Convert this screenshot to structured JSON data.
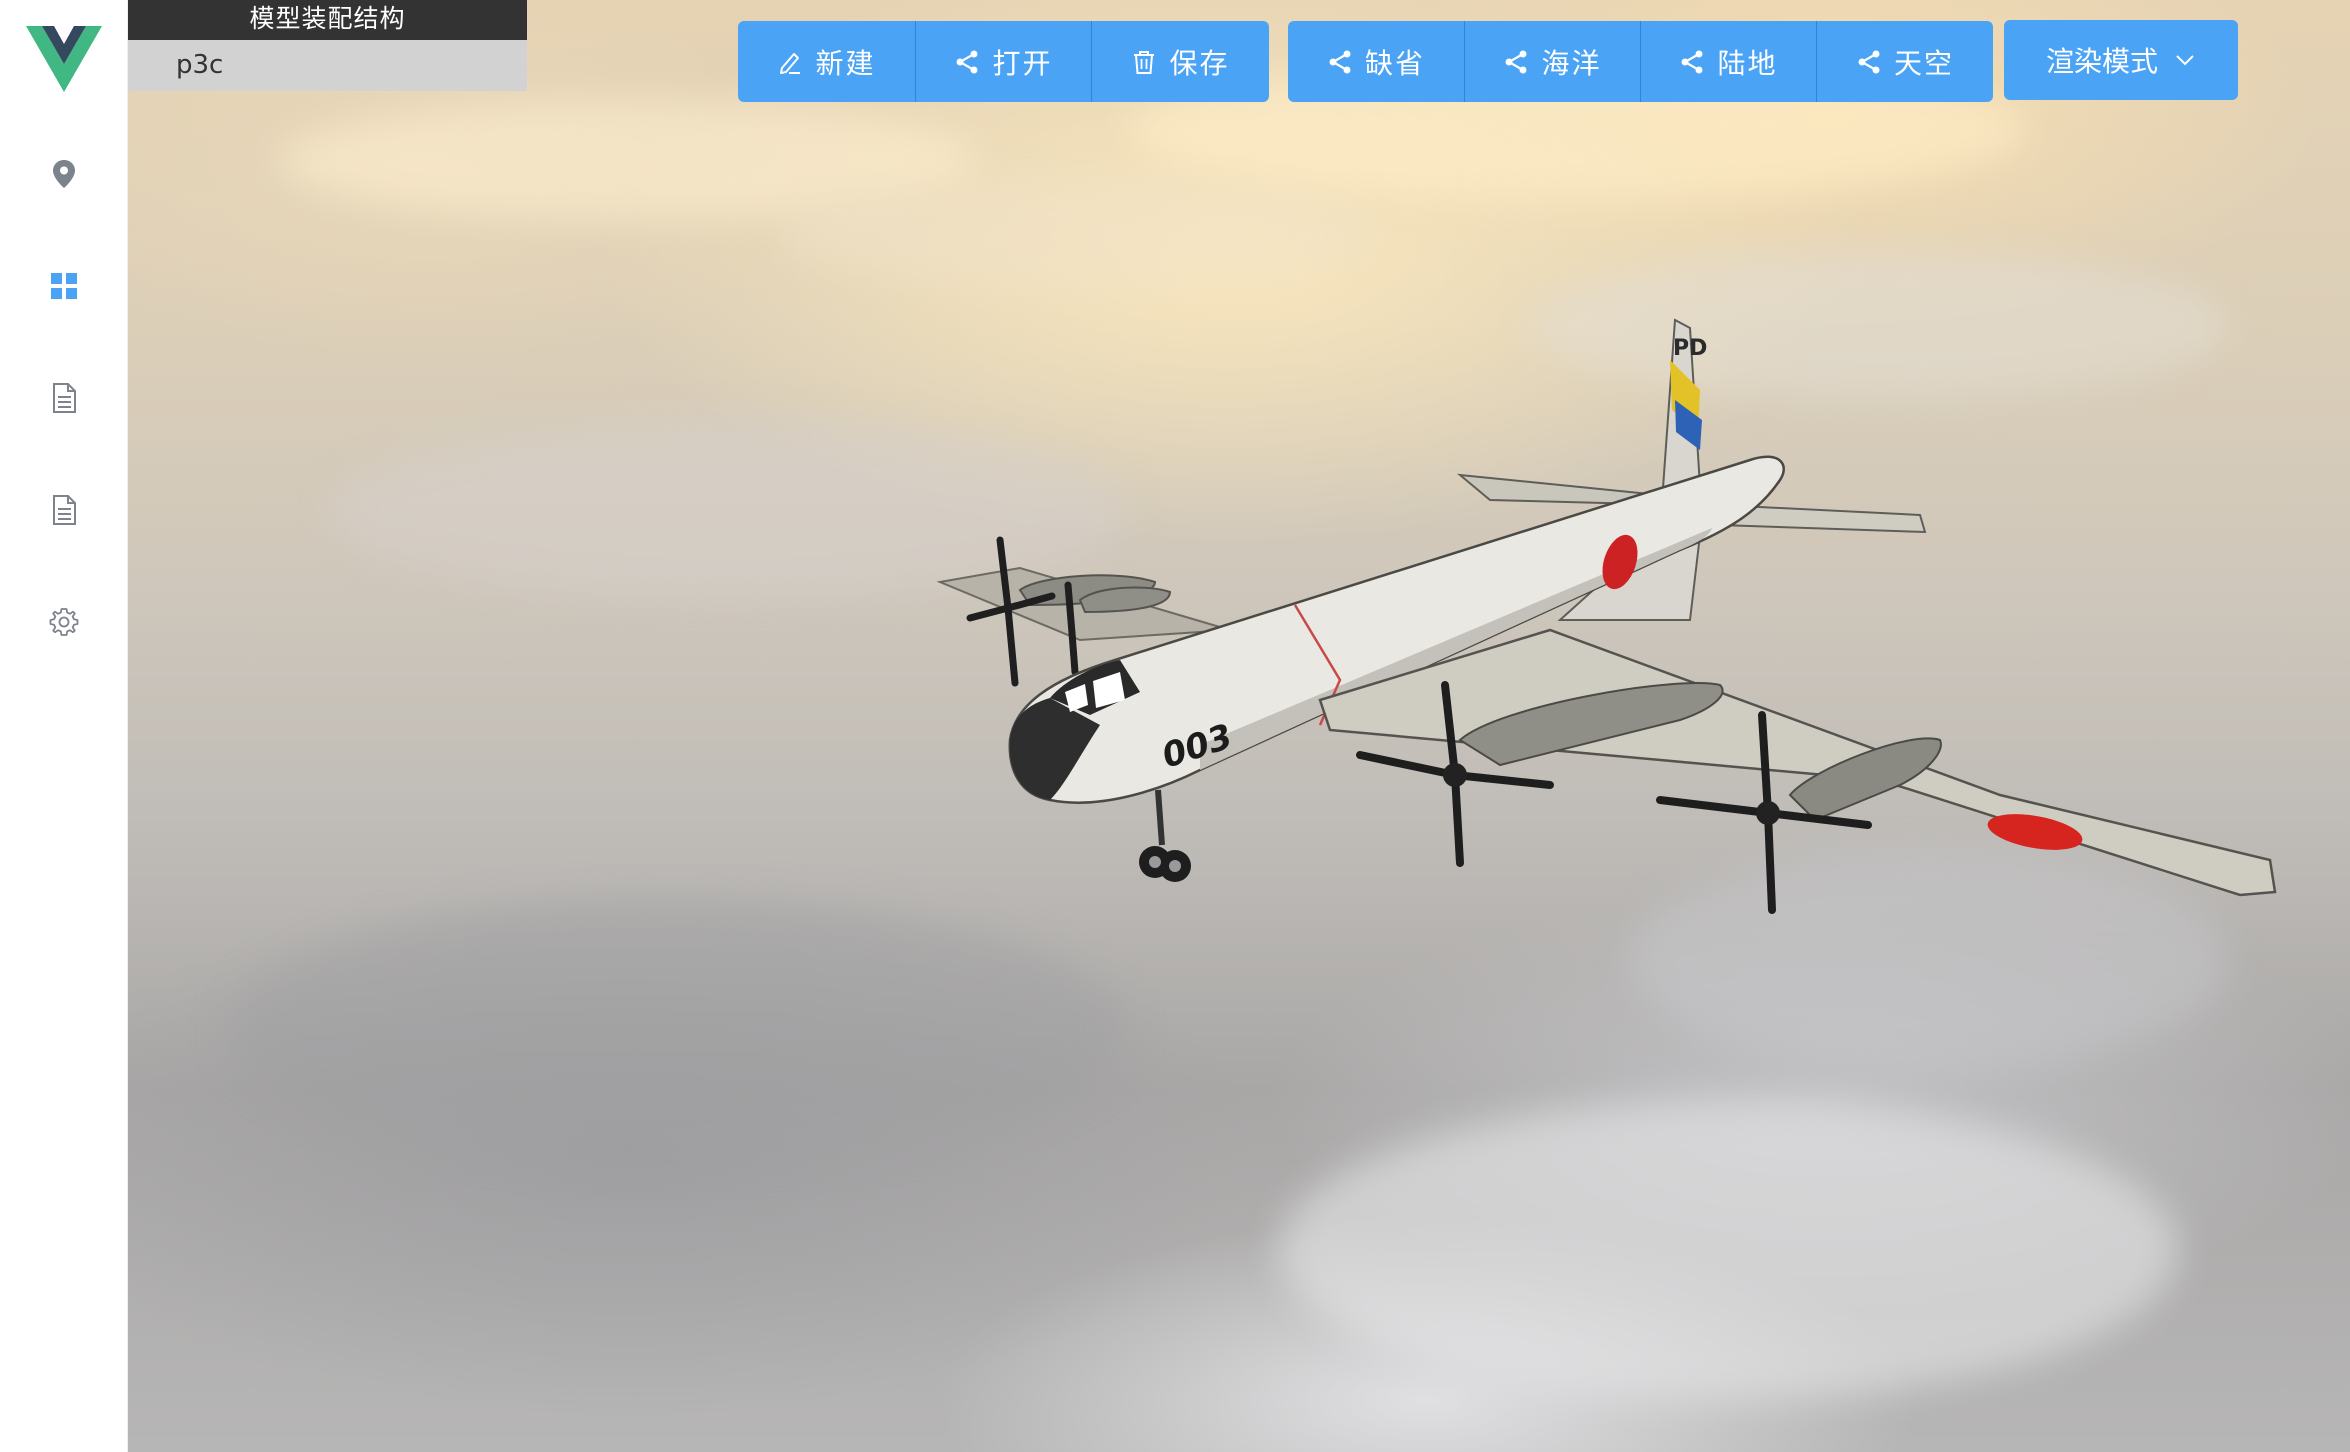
{
  "sidebar": {
    "logo": "vue-logo",
    "items": [
      {
        "icon": "location-pin-icon"
      },
      {
        "icon": "grid-icon",
        "active": true
      },
      {
        "icon": "document-icon"
      },
      {
        "icon": "document-icon"
      },
      {
        "icon": "gear-icon"
      }
    ],
    "accent_color": "#4aa3f5"
  },
  "panel": {
    "title": "模型装配结构",
    "items": [
      "p3c"
    ]
  },
  "toolbar": {
    "file_buttons": [
      {
        "label": "新建",
        "icon": "edit-icon"
      },
      {
        "label": "打开",
        "icon": "share-icon"
      },
      {
        "label": "保存",
        "icon": "trash-icon"
      }
    ],
    "scene_buttons": [
      {
        "label": "缺省",
        "icon": "share-icon"
      },
      {
        "label": "海洋",
        "icon": "share-icon"
      },
      {
        "label": "陆地",
        "icon": "share-icon"
      },
      {
        "label": "天空",
        "icon": "share-icon"
      }
    ],
    "render_mode": {
      "label": "渲染模式",
      "icon": "chevron-down-icon"
    },
    "button_color": "#4aa3f5"
  },
  "scene": {
    "background": "sky",
    "model": {
      "name": "p3c",
      "tail_code": "PD",
      "nose_number": "003"
    }
  }
}
